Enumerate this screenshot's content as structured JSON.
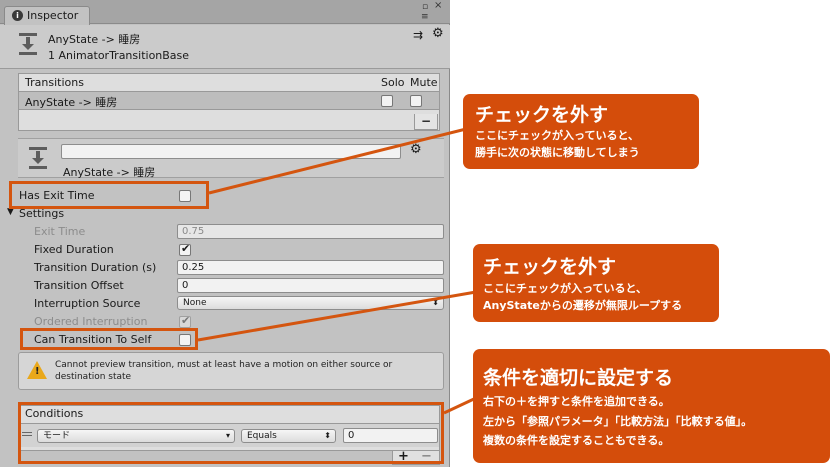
{
  "window": {
    "tab_label": "Inspector",
    "tab_icon": "info-icon",
    "controls": {
      "lock": "lock-icon",
      "menu": "menu-icon",
      "close": "close-icon"
    }
  },
  "header": {
    "title": "AnyState -> 睡房",
    "subtitle": "1 AnimatorTransitionBase"
  },
  "transitions": {
    "heading": "Transitions",
    "solo_label": "Solo",
    "mute_label": "Mute",
    "rows": [
      {
        "name": "AnyState -> 睡房",
        "solo": false,
        "mute": false
      }
    ],
    "minus_label": "−"
  },
  "preview": {
    "name_value": "",
    "caption": "AnyState -> 睡房"
  },
  "settings": {
    "has_exit_time_label": "Has Exit Time",
    "has_exit_time": false,
    "heading": "Settings",
    "exit_time_label": "Exit Time",
    "exit_time_value": "0.75",
    "fixed_duration_label": "Fixed Duration",
    "fixed_duration": true,
    "transition_duration_label": "Transition Duration (s)",
    "transition_duration_value": "0.25",
    "transition_offset_label": "Transition Offset",
    "transition_offset_value": "0",
    "interruption_source_label": "Interruption Source",
    "interruption_source_value": "None",
    "ordered_interruption_label": "Ordered Interruption",
    "ordered_interruption": true,
    "can_transition_label": "Can Transition To Self",
    "can_transition_to_self": false
  },
  "warning": {
    "text": "Cannot preview transition, must at least have a motion on either source or destination state"
  },
  "conditions": {
    "heading": "Conditions",
    "rows": [
      {
        "parameter": "モード",
        "comparator": "Equals",
        "value": "0"
      }
    ],
    "plus_label": "+",
    "minus_label": "−"
  },
  "callouts": [
    {
      "title": "チェックを外す",
      "lines": [
        "ここにチェックが入っていると、",
        "勝手に次の状態に移動してしまう"
      ]
    },
    {
      "title": "チェックを外す",
      "lines": [
        "ここにチェックが入っていると、",
        "AnyStateからの遷移が無限ループする"
      ]
    },
    {
      "title": "条件を適切に設定する",
      "lines": [
        "右下の＋を押すと条件を追加できる。",
        "左から「参照パラメータ」「比較方法」「比較する値」。",
        "複数の条件を設定することもできる。"
      ]
    }
  ],
  "colors": {
    "accent": "#d44d0b",
    "window_bg": "#c2c2c2",
    "panel_bg": "#dedede"
  }
}
